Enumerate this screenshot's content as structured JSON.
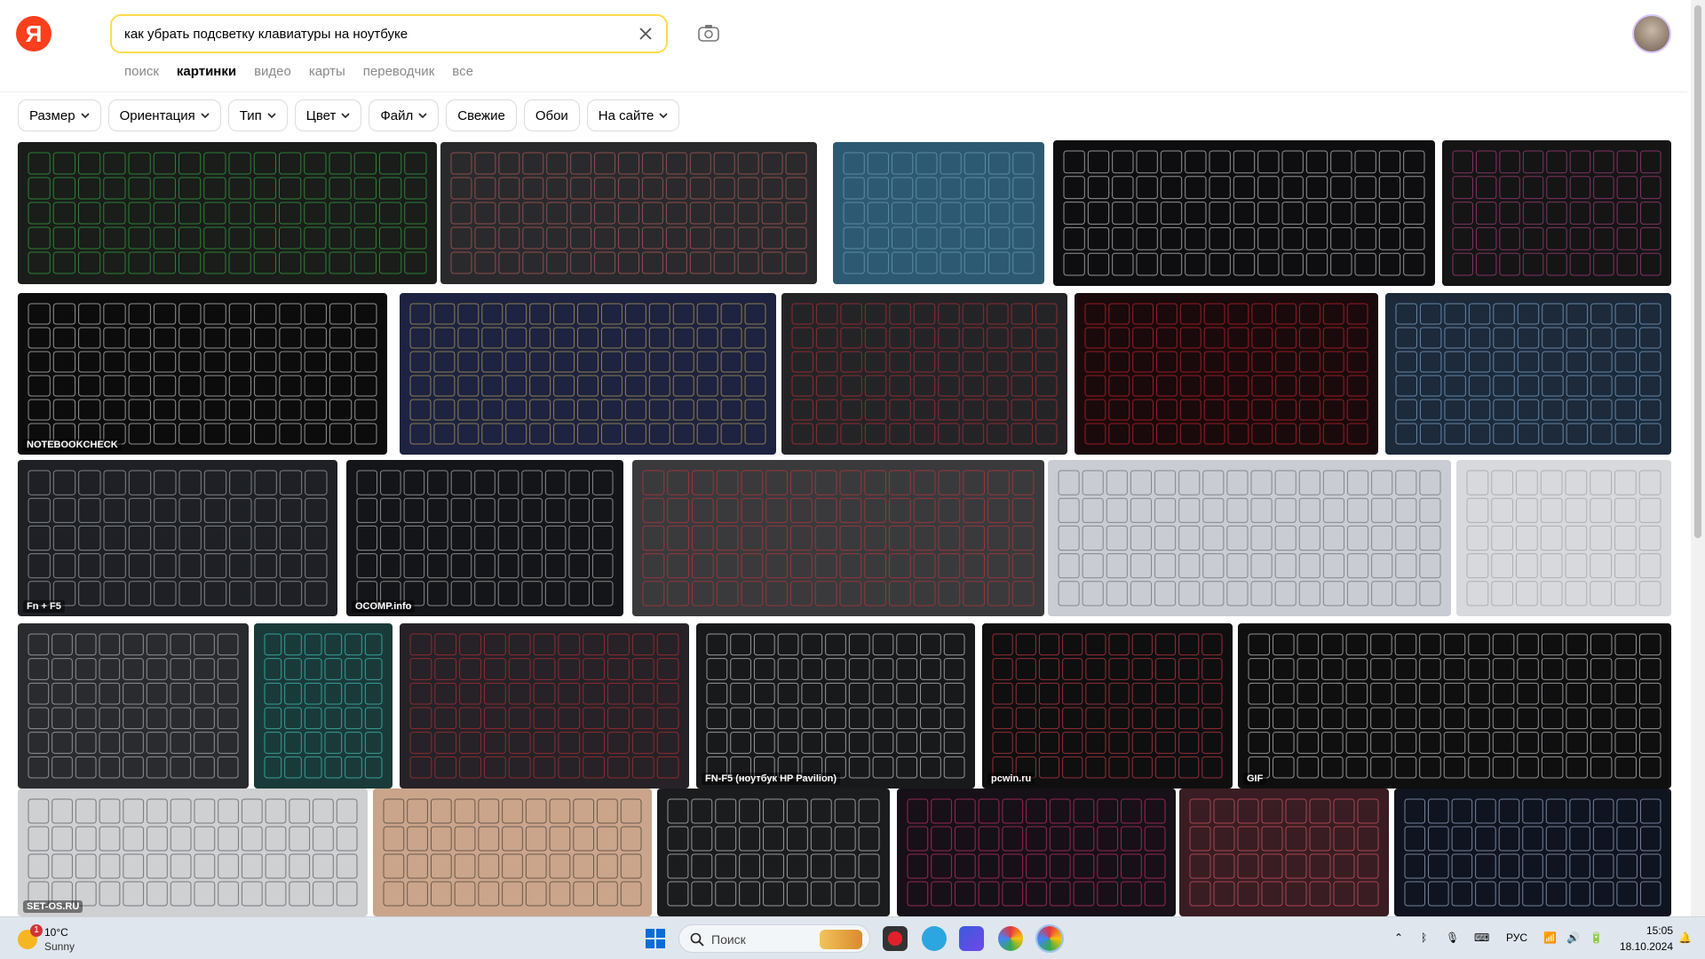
{
  "search": {
    "query": "как убрать подсветку клавиатуры на ноутбуке"
  },
  "logo": {
    "letter": "Я"
  },
  "tabs": [
    {
      "label": "поиск",
      "active": false
    },
    {
      "label": "картинки",
      "active": true
    },
    {
      "label": "видео",
      "active": false
    },
    {
      "label": "карты",
      "active": false
    },
    {
      "label": "переводчик",
      "active": false
    },
    {
      "label": "все",
      "active": false
    }
  ],
  "filters": [
    {
      "label": "Размер",
      "dropdown": true
    },
    {
      "label": "Ориентация",
      "dropdown": true
    },
    {
      "label": "Тип",
      "dropdown": true
    },
    {
      "label": "Цвет",
      "dropdown": true
    },
    {
      "label": "Файл",
      "dropdown": true
    },
    {
      "label": "Свежие",
      "dropdown": false
    },
    {
      "label": "Обои",
      "dropdown": false
    },
    {
      "label": "На сайте",
      "dropdown": true
    }
  ],
  "images": [
    {
      "bg": "#1a1d1a",
      "key": "#3fcf4f",
      "caption": ""
    },
    {
      "bg": "#2a2a2c",
      "key": "#e06a6a",
      "caption": ""
    },
    {
      "bg": "#2d5a72",
      "key": "#7fb3c8",
      "caption": ""
    },
    {
      "bg": "#0e0e10",
      "key": "#ffffff",
      "caption": ""
    },
    {
      "bg": "#151516",
      "key": "#d94fa0",
      "caption": ""
    },
    {
      "bg": "#0c0c0d",
      "key": "#ffffff",
      "caption": "NOTEBOOKCHECK"
    },
    {
      "bg": "#1d2340",
      "key": "#e8c95e",
      "caption": ""
    },
    {
      "bg": "#242427",
      "key": "#e0333d",
      "caption": ""
    },
    {
      "bg": "#1a0a0c",
      "key": "#ff2a3a",
      "caption": ""
    },
    {
      "bg": "#1c2a3a",
      "key": "#9fd0ff",
      "caption": ""
    },
    {
      "bg": "#1e2025",
      "key": "#cfd3d8",
      "caption": "Fn + F5"
    },
    {
      "bg": "#141518",
      "key": "#e8e8e8",
      "caption": "OCOMP.info"
    },
    {
      "bg": "#3a3a3c",
      "key": "#e0333d",
      "caption": ""
    },
    {
      "bg": "#c9ccd3",
      "key": "#4a4f57",
      "caption": ""
    },
    {
      "bg": "#d7d9dd",
      "key": "#8a8d93",
      "caption": ""
    },
    {
      "bg": "#2a2b2e",
      "key": "#e0e0e0",
      "caption": ""
    },
    {
      "bg": "#1a3a3a",
      "key": "#50f0e0",
      "caption": ""
    },
    {
      "bg": "#262227",
      "key": "#e0333d",
      "caption": ""
    },
    {
      "bg": "#18191b",
      "key": "#ffffff",
      "caption": "FN-F5 (ноутбук HP Pavilion)"
    },
    {
      "bg": "#0f0f10",
      "key": "#ff4a5a",
      "caption": "pcwin.ru"
    },
    {
      "bg": "#0f0f10",
      "key": "#ffffff",
      "caption": "GIF"
    },
    {
      "bg": "#cfd0d2",
      "key": "#303236",
      "caption": "SET-OS.RU"
    },
    {
      "bg": "#caa58b",
      "key": "#1b1c1e",
      "caption": ""
    },
    {
      "bg": "#1b1c1e",
      "key": "#ffffff",
      "caption": ""
    },
    {
      "bg": "#171018",
      "key": "#ff3a8a",
      "caption": ""
    },
    {
      "bg": "#3a1d22",
      "key": "#ff6a7a",
      "caption": ""
    },
    {
      "bg": "#101420",
      "key": "#c9dcff",
      "caption": ""
    }
  ],
  "taskbar": {
    "weather_temp": "10°C",
    "weather_desc": "Sunny",
    "weather_badge": "1",
    "search_label": "Поиск",
    "lang": "РУС",
    "time": "15:05",
    "date": "18.10.2024"
  }
}
